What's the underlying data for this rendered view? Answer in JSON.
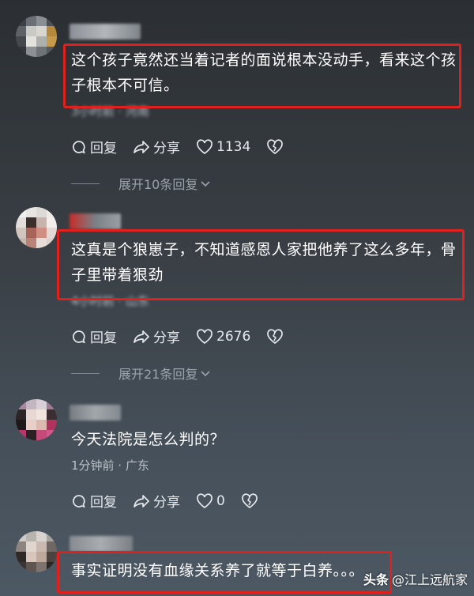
{
  "comments": [
    {
      "text": "这个孩子竟然还当着记者的面说根本没动手，看来这个孩子根本不可信。",
      "meta": "3小时前 · 河南",
      "reply_label": "回复",
      "share_label": "分享",
      "likes": "1134",
      "expand_label": "展开10条回复"
    },
    {
      "text": "这真是个狼崽子，不知道感恩人家把他养了这么多年，骨子里带着狠劲",
      "meta": "4小时前 · 山东",
      "reply_label": "回复",
      "share_label": "分享",
      "likes": "2676",
      "expand_label": "展开21条回复"
    },
    {
      "text": "今天法院是怎么判的？",
      "meta": "1分钟前 · 广东",
      "reply_label": "回复",
      "share_label": "分享",
      "likes": "0"
    },
    {
      "text": "事实证明没有血缘关系养了就等于白养。。。"
    }
  ],
  "watermark": {
    "logo": "头条",
    "handle": "@江上远航家"
  },
  "colors": {
    "highlight_border": "#e0201c",
    "meta_text": "#b9c0c7"
  }
}
